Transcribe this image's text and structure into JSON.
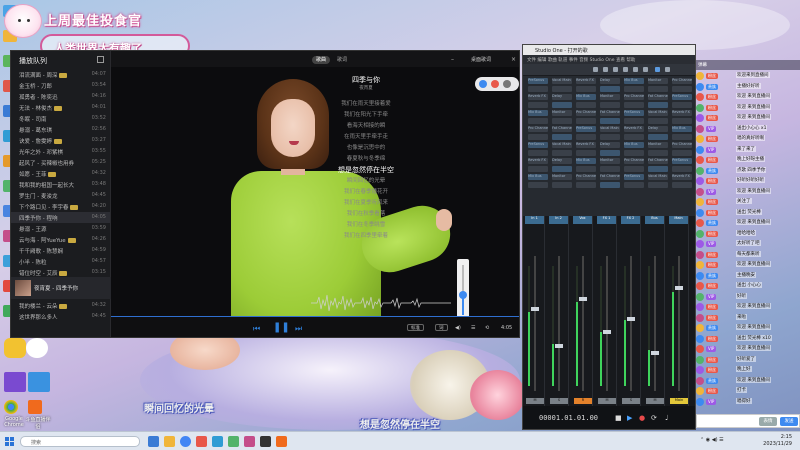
{
  "overlay": {
    "title": "上周最佳投食官",
    "subtitle": "人类世界太有趣了"
  },
  "player": {
    "sidebar_title": "播放队列",
    "songs": [
      {
        "title": "泪流满面 - 周深",
        "dur": "04:07"
      },
      {
        "title": "金玉桥 - 刀郎",
        "dur": "03:54"
      },
      {
        "title": "孤勇者 - 陈奕迅",
        "dur": "04:16"
      },
      {
        "title": "无法 - 林俊杰",
        "dur": "04:01"
      },
      {
        "title": "冬眠 - 司南",
        "dur": "03:52"
      },
      {
        "title": "悬溺 - 葛东琪",
        "dur": "02:56"
      },
      {
        "title": "诀爱 - 詹雯婷",
        "dur": "03:27"
      },
      {
        "title": "光年之外 - 邓紫棋",
        "dur": "03:55"
      },
      {
        "title": "起风了 - 买辣椒也用券",
        "dur": "05:25"
      },
      {
        "title": "如愿 - 王菲",
        "dur": "04:32"
      },
      {
        "title": "我和我的祖国一起长大",
        "dur": "03:48"
      },
      {
        "title": "罗生门 - 麦浚龙",
        "dur": "04:45"
      },
      {
        "title": "下个路口见 - 李宇春",
        "dur": "04:20"
      },
      {
        "title": "四季予你 - 程响",
        "dur": "04:05"
      },
      {
        "title": "悬溺 - 王源",
        "dur": "03:59"
      },
      {
        "title": "云与海 - 阿YueYue",
        "dur": "04:26"
      },
      {
        "title": "千千阙歌 - 陈慧娴",
        "dur": "04:59"
      },
      {
        "title": "小半 - 陈粒",
        "dur": "04:57"
      },
      {
        "title": "错位时空 - 艾辰",
        "dur": "03:15"
      },
      {
        "title": "星辰大海 - 黄霄雲",
        "dur": "03:50"
      },
      {
        "title": "大鱼 - 周深",
        "dur": "05:13"
      },
      {
        "title": "我的楼兰 - 云朵",
        "dur": "04:32"
      },
      {
        "title": "这世界那么多人",
        "dur": "04:45"
      }
    ],
    "now_playing_label": "夜宵夏 - 四季予你",
    "tabs": {
      "t1": "歌曲",
      "t2": "歌词"
    },
    "top_label_1": "桌面歌词",
    "top_label_2": "调整歌词",
    "song_title": "四季与你",
    "song_artist": "夜宵夏",
    "lyrics": [
      {
        "text": "我们在雨天里接着爱",
        "current": false
      },
      {
        "text": "我们在阳光下手牵",
        "current": false
      },
      {
        "text": "看海天相接的瞬",
        "current": false
      },
      {
        "text": "在雨天里手牵手走",
        "current": false
      },
      {
        "text": "也像是沉思中的",
        "current": false
      },
      {
        "text": "春夏秋与冬季绵",
        "current": false
      },
      {
        "text": "想是忽然停在半空",
        "current": true
      },
      {
        "text": "瞬间回忆的光晕",
        "current": false
      },
      {
        "text": "我们在春季播花开",
        "current": false
      },
      {
        "text": "我们在夏季听风来",
        "current": false
      },
      {
        "text": "我们在秋季看落",
        "current": false
      },
      {
        "text": "我们在冬季眺雪",
        "current": false
      },
      {
        "text": "我们在四季里牵着",
        "current": false
      }
    ],
    "volume_percent": 40,
    "progress_percent": 100,
    "quality_label": "标准",
    "mode_label": "词",
    "time_label": "4:05"
  },
  "daw": {
    "title": "Studio One - 打开的歌",
    "menu": "文件  编辑  歌曲  轨道  事件  音频  Studio One  查看  帮助",
    "track_labels": [
      "PreSonus",
      "Vocal Main",
      "Reverb FX",
      "Delay",
      "Mix Bus",
      "Monitor",
      "Pro Channel",
      "Fat Channel"
    ],
    "strip_labels": [
      "In 1",
      "In 2",
      "Vox",
      "FX 1",
      "FX 2",
      "Bus",
      "Main"
    ],
    "strip_levels": [
      0.62,
      0.35,
      0.7,
      0.45,
      0.55,
      0.3,
      0.78
    ],
    "strip_foot_labels": [
      "M",
      "S",
      "R",
      "M",
      "S",
      "M",
      "Main"
    ],
    "time": "00001.01.01.00"
  },
  "chat": {
    "header": "弹幕",
    "messages": [
      {
        "tag": "粉丝",
        "msg": "欢迎来到直播间",
        "tag_color": "#e8584a"
      },
      {
        "tag": "贵族",
        "msg": "主播好好听",
        "tag_color": "#3d8af0"
      },
      {
        "tag": "粉丝",
        "msg": "欢迎 来到直播间",
        "tag_color": "#e8584a"
      },
      {
        "tag": "粉丝",
        "msg": "欢迎 来到直播间",
        "tag_color": "#e8584a"
      },
      {
        "tag": "粉丝",
        "msg": "欢迎 来到直播间",
        "tag_color": "#e8584a"
      },
      {
        "tag": "VIP",
        "msg": "送出小心心 x1",
        "tag_color": "#9d5ae6"
      },
      {
        "tag": "粉丝",
        "msg": "唱的真好听啊",
        "tag_color": "#e8584a"
      },
      {
        "tag": "VIP",
        "msg": "来了来了",
        "tag_color": "#9d5ae6"
      },
      {
        "tag": "粉丝",
        "msg": "晚上好呀主播",
        "tag_color": "#e8584a"
      },
      {
        "tag": "贵族",
        "msg": "点歌 四季予你",
        "tag_color": "#3d8af0"
      },
      {
        "tag": "粉丝",
        "msg": "好听好听好听",
        "tag_color": "#e8584a"
      },
      {
        "tag": "VIP",
        "msg": "欢迎 来到直播间",
        "tag_color": "#9d5ae6"
      },
      {
        "tag": "粉丝",
        "msg": "关注了",
        "tag_color": "#e8584a"
      },
      {
        "tag": "粉丝",
        "msg": "送出 荧光棒",
        "tag_color": "#e8584a"
      },
      {
        "tag": "贵族",
        "msg": "欢迎 来到直播间",
        "tag_color": "#3d8af0"
      },
      {
        "tag": "粉丝",
        "msg": "哈哈哈哈",
        "tag_color": "#e8584a"
      },
      {
        "tag": "VIP",
        "msg": "太好听了吧",
        "tag_color": "#9d5ae6"
      },
      {
        "tag": "粉丝",
        "msg": "每天都来听",
        "tag_color": "#e8584a"
      },
      {
        "tag": "粉丝",
        "msg": "欢迎 来到直播间",
        "tag_color": "#e8584a"
      },
      {
        "tag": "贵族",
        "msg": "主播晚安",
        "tag_color": "#3d8af0"
      },
      {
        "tag": "粉丝",
        "msg": "送出 小心心",
        "tag_color": "#e8584a"
      },
      {
        "tag": "VIP",
        "msg": "好听",
        "tag_color": "#9d5ae6"
      },
      {
        "tag": "粉丝",
        "msg": "欢迎 来到直播间",
        "tag_color": "#e8584a"
      },
      {
        "tag": "粉丝",
        "msg": "来啦",
        "tag_color": "#e8584a"
      },
      {
        "tag": "贵族",
        "msg": "欢迎 来到直播间",
        "tag_color": "#3d8af0"
      },
      {
        "tag": "粉丝",
        "msg": "送出 荧光棒 x10",
        "tag_color": "#e8584a"
      },
      {
        "tag": "VIP",
        "msg": "欢迎 来到直播间",
        "tag_color": "#9d5ae6"
      },
      {
        "tag": "粉丝",
        "msg": "好听爱了",
        "tag_color": "#e8584a"
      },
      {
        "tag": "粉丝",
        "msg": "晚上好",
        "tag_color": "#e8584a"
      },
      {
        "tag": "贵族",
        "msg": "欢迎 来到直播间",
        "tag_color": "#3d8af0"
      },
      {
        "tag": "粉丝",
        "msg": "打卡",
        "tag_color": "#e8584a"
      },
      {
        "tag": "VIP",
        "msg": "唱得好",
        "tag_color": "#9d5ae6"
      }
    ],
    "send_1": "表情",
    "send_2": "发送"
  },
  "subtitles": {
    "left": "瞬间回忆的光晕",
    "right": "想是忽然停在半空"
  },
  "desktop": {
    "icon_labels": [
      "Google Chrome",
      "斗鱼直播伴侣"
    ]
  },
  "taskbar": {
    "search_placeholder": "搜索",
    "clock_time": "2:15",
    "clock_date": "2023/11/29"
  }
}
